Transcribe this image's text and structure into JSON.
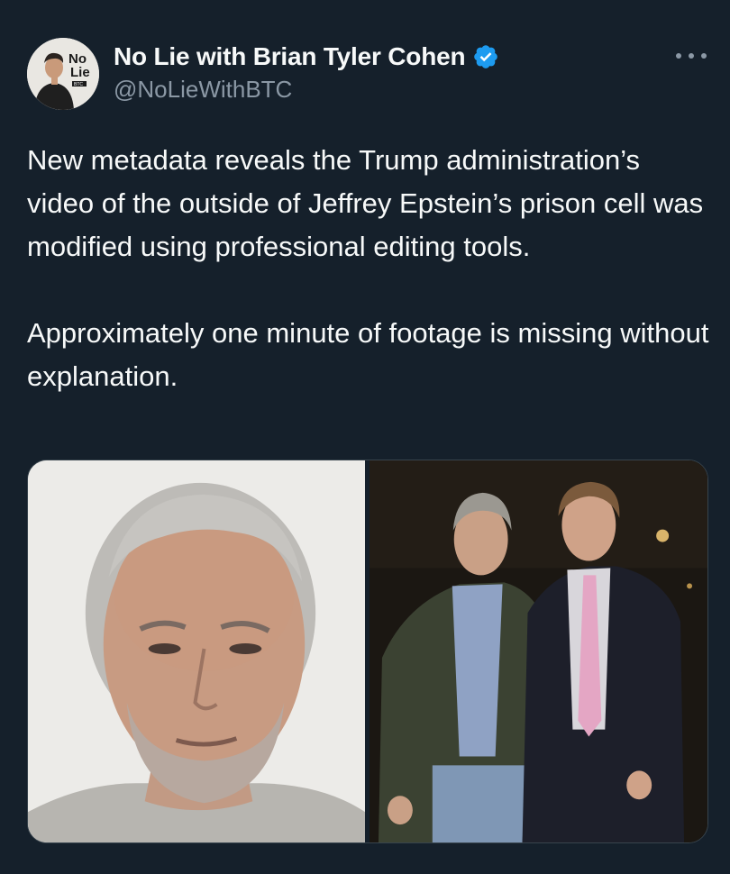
{
  "tweet": {
    "author": {
      "display_name": "No Lie with Brian Tyler Cohen",
      "handle": "@NoLieWithBTC",
      "verified": true,
      "avatar_text_line1": "No",
      "avatar_text_line2": "Lie",
      "avatar_badge_text": "BTC"
    },
    "text_paragraphs": [
      "New metadata reveals the Trump administration’s video of the outside of Jeffrey Epstein’s prison cell was modified using professional editing tools.",
      "Approximately one minute of footage is missing without explanation."
    ],
    "media": [
      {
        "icon": "photo",
        "description_kind": "portrait-photo"
      },
      {
        "icon": "photo",
        "description_kind": "two-men-photo"
      }
    ]
  },
  "colors": {
    "background": "#15202b",
    "text_primary": "#f7f9f9",
    "text_secondary": "#8b98a5",
    "verified_blue": "#1d9bf0",
    "border": "#38444d"
  },
  "icons": {
    "verified": "verified-badge-icon",
    "more": "more-dots-icon"
  }
}
